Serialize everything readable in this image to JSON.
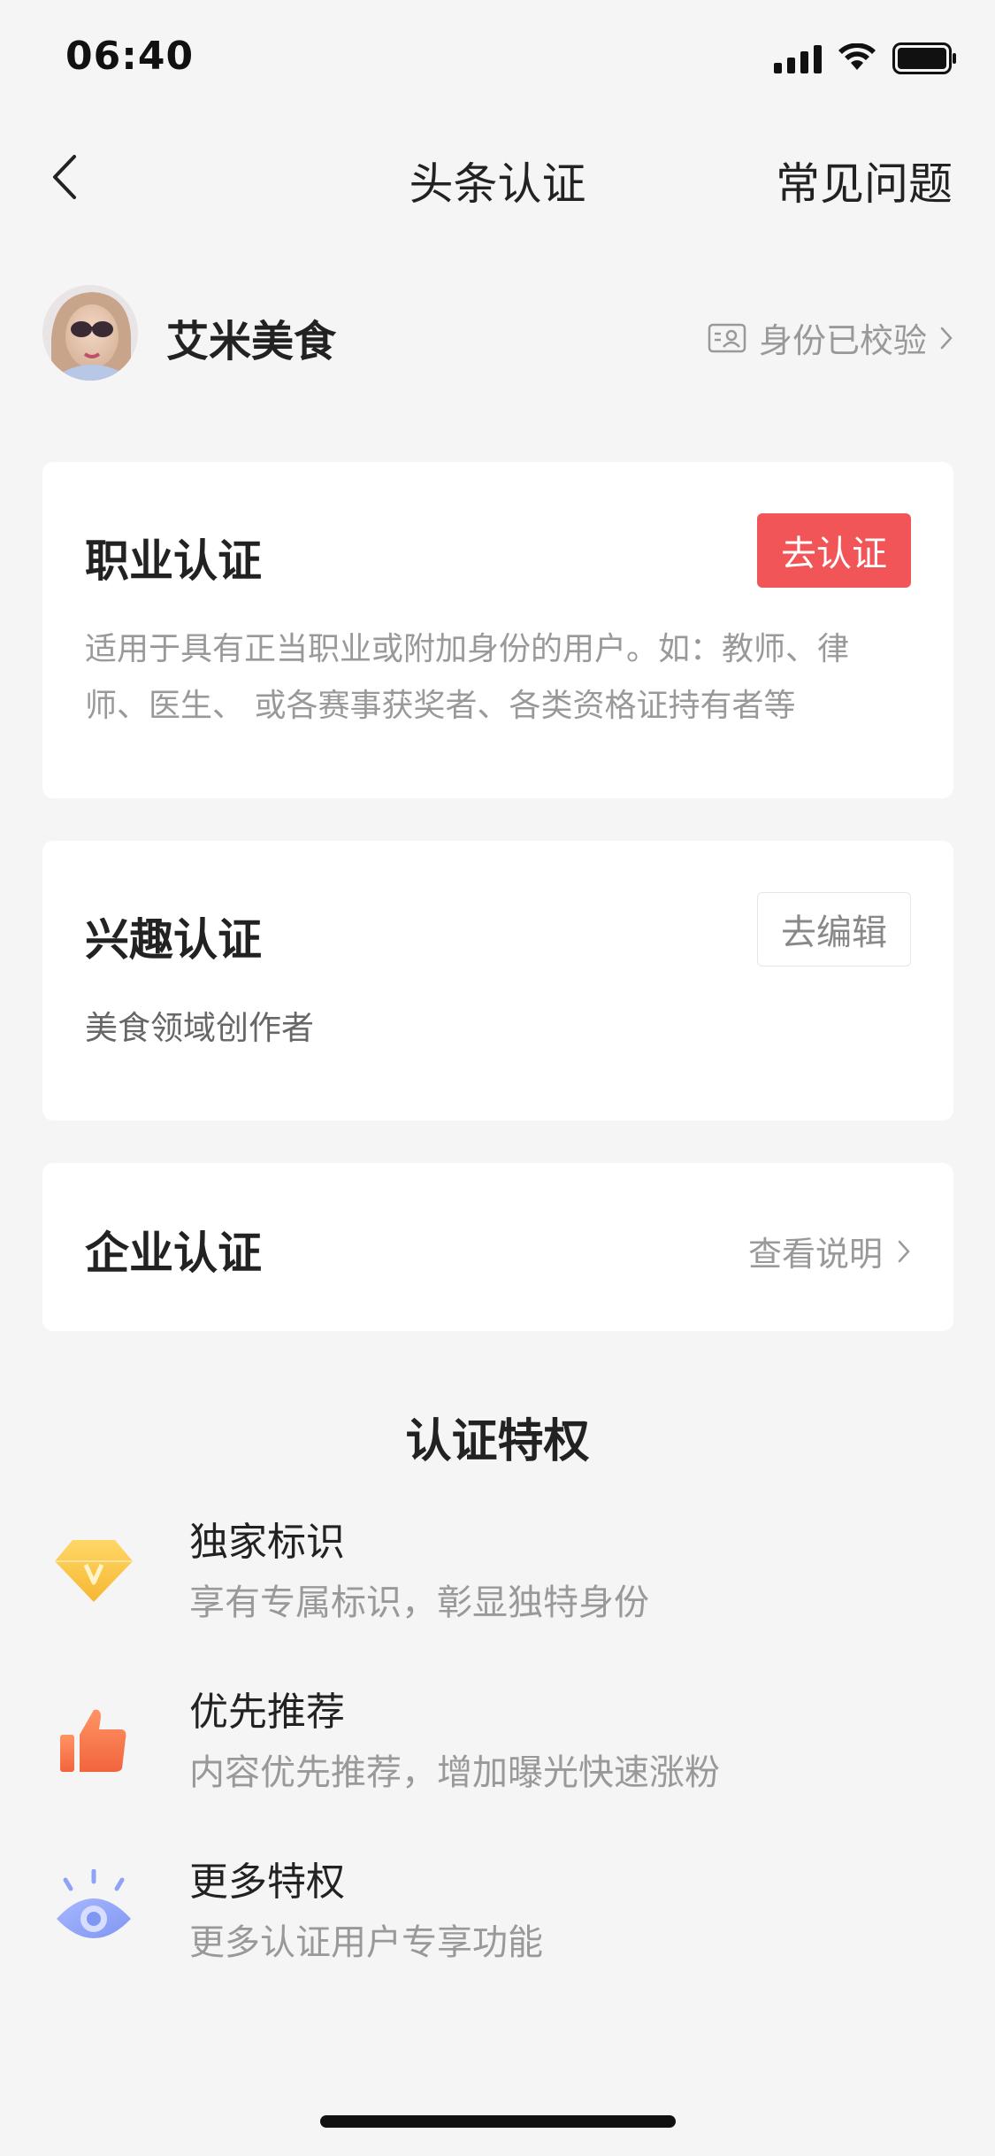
{
  "status_bar": {
    "time": "06:40",
    "icons": [
      "signal-icon",
      "wifi-icon",
      "battery-icon"
    ]
  },
  "nav": {
    "title": "头条认证",
    "faq_label": "常见问题",
    "back_icon": "chevron-left-icon"
  },
  "profile": {
    "username": "艾米美食",
    "verified_label": "身份已校验"
  },
  "cards": {
    "professional": {
      "title": "职业认证",
      "button_label": "去认证",
      "description": "适用于具有正当职业或附加身份的用户。如：教师、律师、医生、 或各赛事获奖者、各类资格证持有者等"
    },
    "interest": {
      "title": "兴趣认证",
      "button_label": "去编辑",
      "description": "美食领域创作者"
    },
    "enterprise": {
      "title": "企业认证",
      "link_label": "查看说明"
    }
  },
  "privileges": {
    "title": "认证特权",
    "items": [
      {
        "icon": "diamond-v-icon",
        "title": "独家标识",
        "description": "享有专属标识，彰显独特身份"
      },
      {
        "icon": "thumbs-up-icon",
        "title": "优先推荐",
        "description": "内容优先推荐，增加曝光快速涨粉"
      },
      {
        "icon": "eye-icon",
        "title": "更多特权",
        "description": "更多认证用户专享功能"
      }
    ]
  },
  "colors": {
    "accent_red": "#f25557",
    "background": "#f5f5f5",
    "card": "#ffffff",
    "muted_text": "#999999"
  }
}
